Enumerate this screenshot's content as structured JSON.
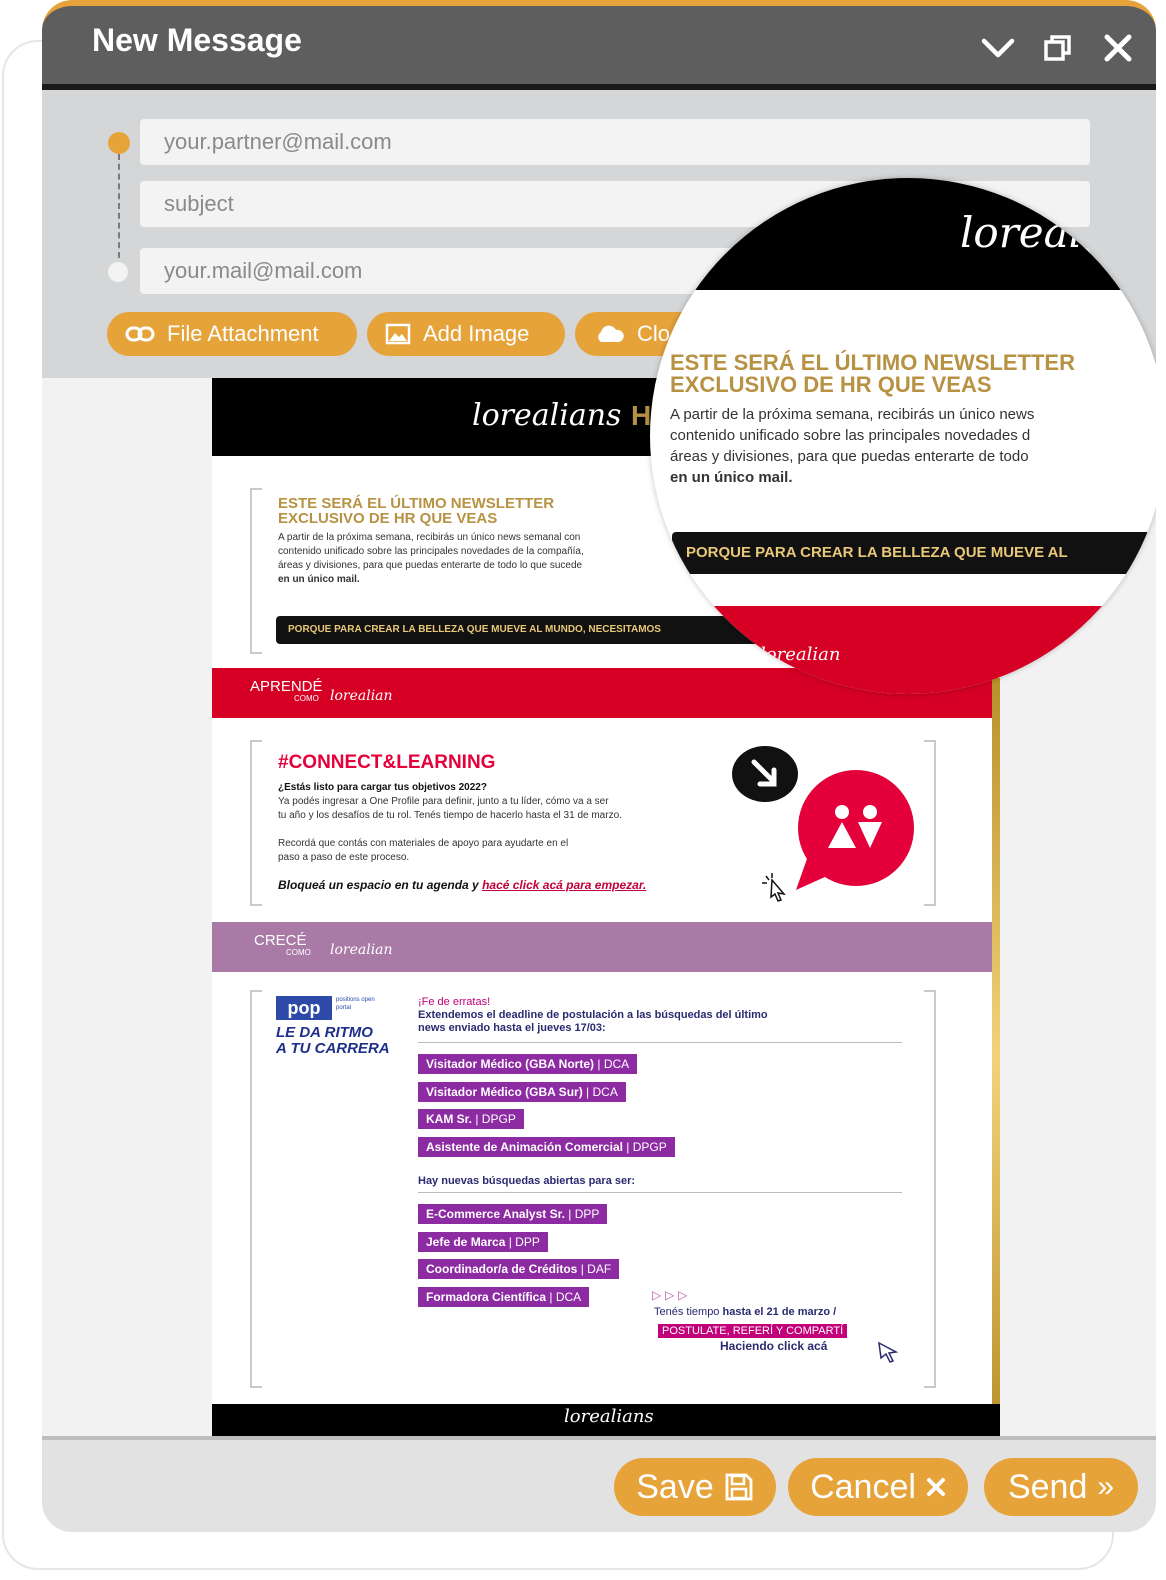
{
  "window": {
    "title": "New Message"
  },
  "compose": {
    "to_placeholder": "your.partner@mail.com",
    "subject_placeholder": "subject",
    "from_placeholder": "your.mail@mail.com"
  },
  "attachments": {
    "file_label": "File Attachment",
    "image_label": "Add Image",
    "cloud_label": "Clo"
  },
  "newsletter": {
    "brand": "loreal",
    "brand_short": "lorealians",
    "header_hr": "HR",
    "intro": {
      "title_line1": "ESTE SERÁ EL ÚLTIMO NEWSLETTER",
      "title_line2": "EXCLUSIVO DE HR QUE VEAS",
      "p1": "A partir de la próxima semana, recibirás un único news semanal con",
      "p2": "contenido unificado sobre las principales novedades de la compañía,",
      "p3": "áreas y divisiones, para que puedas enterarte de todo lo que sucede",
      "p4": "en un único mail.",
      "banner": "PORQUE PARA CREAR LA BELLEZA QUE MUEVE AL MUNDO, NECESITAMOS"
    },
    "aprende": {
      "band_title": "APRENDÉ",
      "band_sub": "COMO",
      "band_brand": "lorealian",
      "heading": "#CONNECT&LEARNING",
      "q": "¿Estás listo para cargar tus objetivos 2022?",
      "l1": "Ya podés ingresar a One Profile para definir, junto a tu líder, cómo va a ser",
      "l2": "tu año y los desafíos de tu rol. Tenés tiempo de hacerlo hasta el 31 de marzo.",
      "l3": "Recordá que contás con materiales de apoyo para ayudarte en el",
      "l4": "paso a paso de este proceso.",
      "cta_prefix": "Bloqueá un espacio en tu agenda y",
      "cta_link": "hacé click acá para empezar."
    },
    "crece": {
      "band_title": "CRECÉ",
      "band_sub": "COMO",
      "band_brand": "lorealian",
      "pop_logo": "pop",
      "pop_small": "positions open portal",
      "slogan1": "LE DA RITMO",
      "slogan2": "A TU CARRERA",
      "errata": "¡Fe de erratas!",
      "errata1": "Extendemos el deadline de postulación a las búsquedas del último",
      "errata2": "news enviado hasta el jueves 17/03:",
      "tags_a": [
        {
          "name": "Visitador Médico (GBA Norte)",
          "code": "| DCA"
        },
        {
          "name": "Visitador Médico (GBA Sur)",
          "code": "| DCA"
        },
        {
          "name": "KAM Sr.",
          "code": "| DPGP"
        },
        {
          "name": "Asistente de Animación Comercial",
          "code": "| DPGP"
        }
      ],
      "new_searches": "Hay nuevas búsquedas abiertas para ser:",
      "tags_b": [
        {
          "name": "E-Commerce Analyst Sr.",
          "code": "| DPP"
        },
        {
          "name": "Jefe de Marca",
          "code": "| DPP"
        },
        {
          "name": "Coordinador/a de Créditos",
          "code": "| DAF"
        },
        {
          "name": "Formadora Científica",
          "code": "| DCA"
        }
      ],
      "deadline_prefix": "Tenés tiempo",
      "deadline_bold": "hasta el 21 de marzo /",
      "postulate": "POSTULATE, REFERÍ Y COMPARTÍ",
      "click_here": "Haciendo click acá"
    }
  },
  "magnifier": {
    "brand": "loreali",
    "title_line1": "ESTE SERÁ EL ÚLTIMO NEWSLETTER",
    "title_line2": "EXCLUSIVO DE HR QUE VEAS",
    "p1": "A partir de la próxima semana, recibirás un único news",
    "p2": "contenido unificado sobre las principales novedades d",
    "p3": "áreas y divisiones, para que puedas enterarte de todo",
    "p4": "en un único mail.",
    "banner": "PORQUE PARA CREAR LA BELLEZA QUE MUEVE AL",
    "red_brand": "lorealian"
  },
  "actions": {
    "save": "Save",
    "cancel": "Cancel",
    "send": "Send"
  },
  "colors": {
    "accent": "#e6a33a",
    "titlebar": "#5e5e5e",
    "loreal_red": "#d50023",
    "purple": "#8d2ba3"
  }
}
